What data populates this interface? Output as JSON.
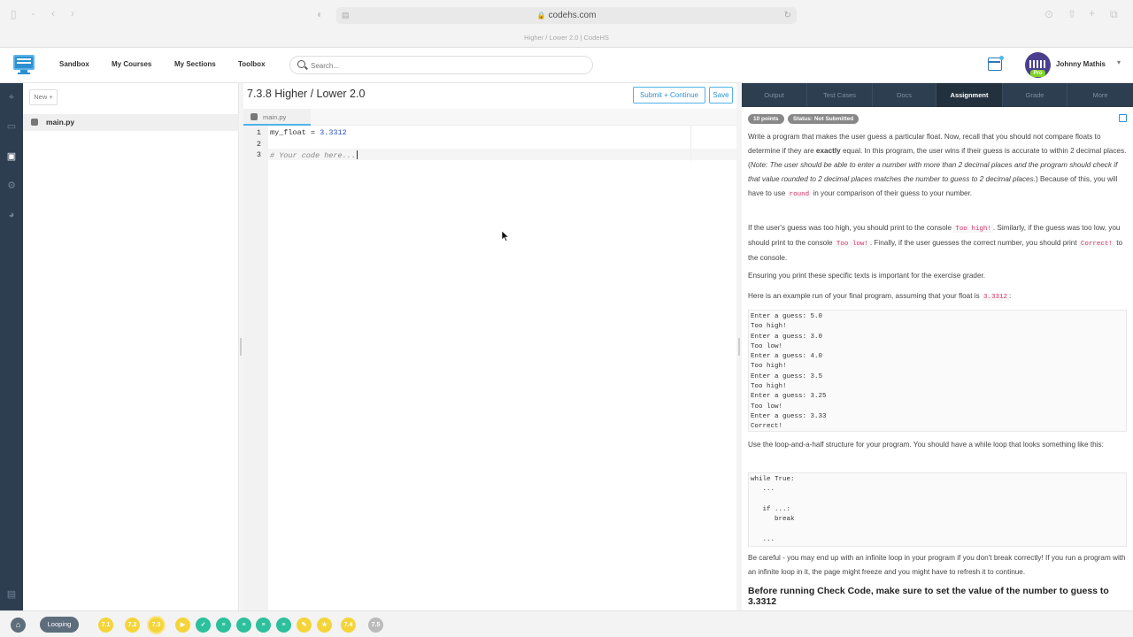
{
  "browser": {
    "url": "codehs.com",
    "tab_title": "Higher / Lower 2.0 | CodeHS"
  },
  "header": {
    "nav": [
      "Sandbox",
      "My Courses",
      "My Sections",
      "Toolbox"
    ],
    "search_placeholder": "Search...",
    "user_name": "Johnny Mathis",
    "pro_badge": "Pro"
  },
  "files": {
    "new_button": "New +",
    "items": [
      "main.py"
    ]
  },
  "editor": {
    "title": "7.3.8 Higher / Lower 2.0",
    "submit_label": "Submit + Continue",
    "save_label": "Save",
    "tab": "main.py",
    "lines": [
      {
        "num": "1",
        "var": "my_float",
        "op": " = ",
        "val": "3.3312"
      },
      {
        "num": "2"
      },
      {
        "num": "3",
        "comment": "# Your code here..."
      }
    ]
  },
  "panel": {
    "tabs": [
      "Output",
      "Test Cases",
      "Docs",
      "Assignment",
      "Grade",
      "More"
    ],
    "active_tab": "Assignment",
    "badges": [
      "10 points",
      "Status: Not Submitted"
    ],
    "p1_a": "Write a program that makes the user guess a particular float. Now, recall that you should not compare floats to determine if they are ",
    "p1_bold": "exactly",
    "p1_b": " equal. In this program, the user wins if their guess is accurate to within 2 decimal places. (",
    "p1_italic": "Note: The user should be able to enter a number with more than 2 decimal places and the program should check if that value rounded to 2 decimal places matches the number to guess to 2 decimal places.",
    "p1_c": ") Because of this, you will have to use ",
    "p1_code": "round",
    "p1_d": " in your comparison of their guess to your number.",
    "p2_a": "If the user's guess was too high, you should print to the console ",
    "p2_code1": "Too high!",
    "p2_b": ". Similarly, if the guess was too low, you should print to the console ",
    "p2_code2": "Too low!",
    "p2_c": ". Finally, if the user guesses the correct number, you should print ",
    "p2_code3": "Correct!",
    "p2_d": " to the console.",
    "p3": "Ensuring you print these specific texts is important for the exercise grader.",
    "p4_a": "Here is an example run of your final program, assuming that your float is ",
    "p4_code": "3.3312",
    "p4_b": ":",
    "example_run": "Enter a guess: 5.0\nToo high!\nEnter a guess: 3.0\nToo low!\nEnter a guess: 4.0\nToo high!\nEnter a guess: 3.5\nToo high!\nEnter a guess: 3.25\nToo low!\nEnter a guess: 3.33\nCorrect!",
    "p5": "Use the loop-and-a-half structure for your program. You should have a while loop that looks something like this:",
    "loop_code": "while True:\n   ...\n\n   if ...:\n      break\n\n   ...",
    "p6": "Be careful - you may end up with an infinite loop in your program if you don't break correctly! If you run a program with an infinite loop in it, the page might freeze and you might have to refresh it to continue.",
    "h_before": "Before running Check Code, make sure to set the value of the number to guess to 3.3312"
  },
  "bottom": {
    "unit_label": "Looping",
    "items": [
      {
        "label": "7.1",
        "color": "#f5d43a"
      },
      {
        "label": "7.2",
        "color": "#f5d43a"
      },
      {
        "label": "7.3",
        "color": "#f5d43a"
      },
      {
        "label": "video-icon",
        "color": "#f5d43a"
      },
      {
        "label": "check-icon",
        "color": "#2cc09c"
      },
      {
        "label": "doc-icon",
        "color": "#2cc09c"
      },
      {
        "label": "doc-icon",
        "color": "#2cc09c"
      },
      {
        "label": "doc-icon",
        "color": "#2cc09c"
      },
      {
        "label": "doc-icon",
        "color": "#2cc09c"
      },
      {
        "label": "pencil-icon",
        "color": "#f5d43a"
      },
      {
        "label": "star-icon",
        "color": "#f5d43a"
      },
      {
        "label": "7.4",
        "color": "#f5d43a"
      },
      {
        "label": "7.5",
        "color": "#bbbbbb"
      }
    ]
  }
}
